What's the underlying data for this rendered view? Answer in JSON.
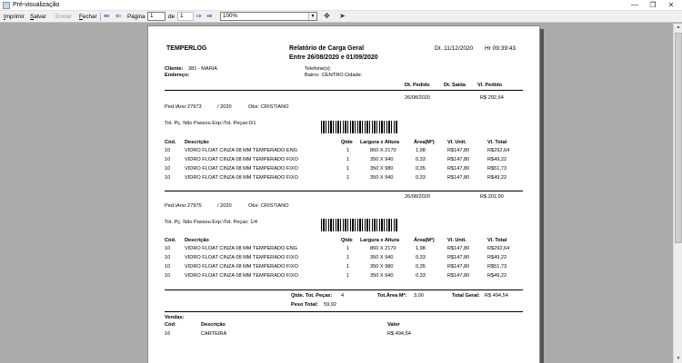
{
  "window": {
    "title": "Pré-visualização",
    "minimize": "—",
    "maximize": "❐",
    "close": "✕"
  },
  "toolbar": {
    "print": "Imprimir",
    "save": "Salvar",
    "send": "Enviar",
    "close": "Fechar",
    "page_label": "Página",
    "page_value": "1",
    "of_label": "de",
    "total_pages": "1",
    "zoom_value": "100%"
  },
  "report": {
    "company": "TEMPERLOG",
    "title": "Relatório de Carga Geral",
    "period": "Entre 26/08/2020 e 01/09/2020",
    "date": "Dt. 11/12/2020",
    "time": "Hr 09:39:43",
    "client_label": "Cliente:",
    "client_value": "381 - MARIA",
    "address_label": "Endereço:",
    "phone_label": "Telefone(s):",
    "bairro_label": "Bairro:",
    "bairro_value": "CENTRO",
    "cidade_label": "Cidade:",
    "col_dt_pedido": "Dt. Pedido",
    "col_dt_saida": "Dt. Saída",
    "col_vl_pedido": "Vl. Pedido",
    "item_headers": [
      "Cód.",
      "Descrição",
      "Qtde",
      "Largura x Altura",
      "Área(M²)",
      "Vl. Unit.",
      "Vl. Total"
    ],
    "orders": [
      {
        "date": "26/08/2020",
        "total": "R$ 292,64",
        "ped_label": "Ped.\\Ano:",
        "ped_no": "27973",
        "ped_year": "/ 2020",
        "obs_label": "Obs:",
        "obs": "CRISTIANO",
        "pieces": "Tot. Pç. Não Passou Exp.\\Tot. Peças:0/1",
        "items": [
          {
            "cod": "10",
            "desc": "VIDRO FLOAT CINZA 08 MM TEMPERADO ENG",
            "qtde": "1",
            "dim": "860 X 2170",
            "area": "1,98",
            "unit": "R$147,80",
            "total": "R$292,64"
          },
          {
            "cod": "10",
            "desc": "VIDRO FLOAT CINZA 08 MM TEMPERADO FIXO",
            "qtde": "1",
            "dim": "350 X 940",
            "area": "0,33",
            "unit": "R$147,80",
            "total": "R$49,22"
          },
          {
            "cod": "10",
            "desc": "VIDRO FLOAT CINZA 08 MM TEMPERADO FIXO",
            "qtde": "1",
            "dim": "350 X 980",
            "area": "0,35",
            "unit": "R$147,80",
            "total": "R$51,73"
          },
          {
            "cod": "10",
            "desc": "VIDRO FLOAT CINZA 08 MM TEMPERADO FIXO",
            "qtde": "1",
            "dim": "350 X 940",
            "area": "0,33",
            "unit": "R$147,80",
            "total": "R$49,22"
          }
        ]
      },
      {
        "date": "26/08/2020",
        "total": "R$ 201,90",
        "ped_label": "Ped.\\Ano:",
        "ped_no": "27975",
        "ped_year": "/ 2020",
        "obs_label": "Obs:",
        "obs": "CRISTIANO",
        "pieces": "Tot. Pç. Não Passou Exp.\\Tot. Peças: 1/4",
        "items": [
          {
            "cod": "10",
            "desc": "VIDRO FLOAT CINZA 08 MM TEMPERADO ENG",
            "qtde": "1",
            "dim": "860 X 2170",
            "area": "1,98",
            "unit": "R$147,80",
            "total": "R$292,64"
          },
          {
            "cod": "10",
            "desc": "VIDRO FLOAT CINZA 08 MM TEMPERADO FIXO",
            "qtde": "1",
            "dim": "350 X 940",
            "area": "0,33",
            "unit": "R$147,80",
            "total": "R$49,22"
          },
          {
            "cod": "10",
            "desc": "VIDRO FLOAT CINZA 08 MM TEMPERADO FIXO",
            "qtde": "1",
            "dim": "350 X 980",
            "area": "0,35",
            "unit": "R$147,80",
            "total": "R$51,73"
          },
          {
            "cod": "10",
            "desc": "VIDRO FLOAT CINZA 08 MM TEMPERADO FIXO",
            "qtde": "1",
            "dim": "350 X 940",
            "area": "0,33",
            "unit": "R$147,80",
            "total": "R$49,22"
          }
        ]
      }
    ],
    "totals": {
      "pieces_label": "Qtde. Tot. Peças:",
      "pieces_value": "4",
      "area_label": "Tot.Área M²:",
      "area_value": "3,00",
      "general_label": "Total Geral:",
      "general_value": "R$ 494,54",
      "weight_label": "Peso Total:",
      "weight_value": "59,92"
    },
    "sales": {
      "label": "Vendas:",
      "headers": [
        "Cód:",
        "Descrição",
        "Valor"
      ],
      "rows": [
        {
          "cod": "16",
          "desc": "CARTEIRA",
          "value": "R$ 494,54"
        }
      ]
    }
  }
}
